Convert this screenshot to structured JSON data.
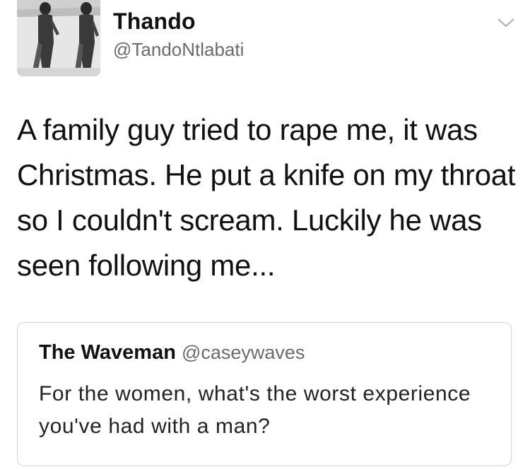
{
  "tweet": {
    "author_name": "Thando",
    "author_handle": "@TandoNtlabati",
    "avatar_icon": "profile-photo",
    "menu_icon": "chevron-down-icon",
    "text": "A family guy tried to rape me, it was Christmas. He put a knife on my throat so I couldn't scream. Luckily he was seen following me..."
  },
  "quoted_tweet": {
    "author_name": "The Waveman",
    "author_handle": "@caseywaves",
    "text": "For the women, what's the worst experience you've had with a man?"
  },
  "colors": {
    "text": "#111111",
    "secondary_text": "#6b6b6b",
    "border": "#d4d4d4",
    "background": "#ffffff"
  }
}
